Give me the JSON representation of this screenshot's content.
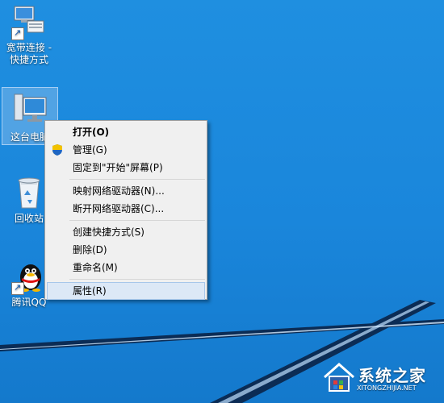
{
  "desktop": {
    "icons": [
      {
        "label_line1": "宽带连接 -",
        "label_line2": "快捷方式",
        "icon": "network-computers-icon"
      },
      {
        "label": "这台电脑",
        "icon": "this-pc-icon"
      },
      {
        "label": "回收站",
        "icon": "recycle-bin-icon"
      },
      {
        "label": "腾讯QQ",
        "icon": "qq-penguin-icon"
      }
    ]
  },
  "context_menu": {
    "items": [
      {
        "label": "打开(O)"
      },
      {
        "label": "管理(G)",
        "icon": "uac-shield-icon"
      },
      {
        "label": "固定到\"开始\"屏幕(P)"
      },
      {
        "label": "映射网络驱动器(N)..."
      },
      {
        "label": "断开网络驱动器(C)..."
      },
      {
        "label": "创建快捷方式(S)"
      },
      {
        "label": "删除(D)"
      },
      {
        "label": "重命名(M)"
      },
      {
        "label": "属性(R)"
      }
    ]
  },
  "watermark": {
    "title": "系统之家",
    "subtitle": "XITONGZHIJIA.NET"
  },
  "colors": {
    "desktop_blue": "#1a86db",
    "menu_bg": "#f0f0f0",
    "highlight": "#dce8f6"
  }
}
